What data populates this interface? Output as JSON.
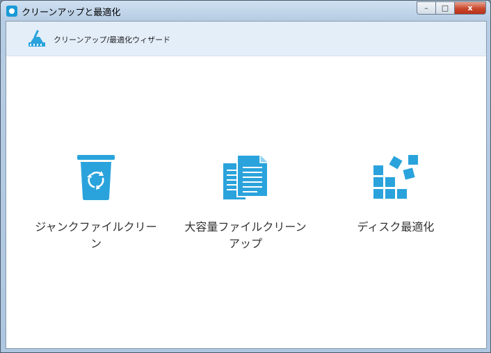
{
  "window": {
    "title": "クリーンアップと最適化",
    "controls": {
      "minimize": "–",
      "maximize": "□",
      "close": "x"
    }
  },
  "wizard": {
    "title": "クリーンアップ/最適化ウィザード"
  },
  "options": [
    {
      "label": "ジャンクファイルクリーン",
      "icon": "recycle-bin-icon"
    },
    {
      "label": "大容量ファイルクリーンアップ",
      "icon": "documents-icon"
    },
    {
      "label": "ディスク最適化",
      "icon": "defrag-blocks-icon"
    }
  ],
  "colors": {
    "accent": "#2aa3dc",
    "header_bg": "#e4eef9"
  }
}
